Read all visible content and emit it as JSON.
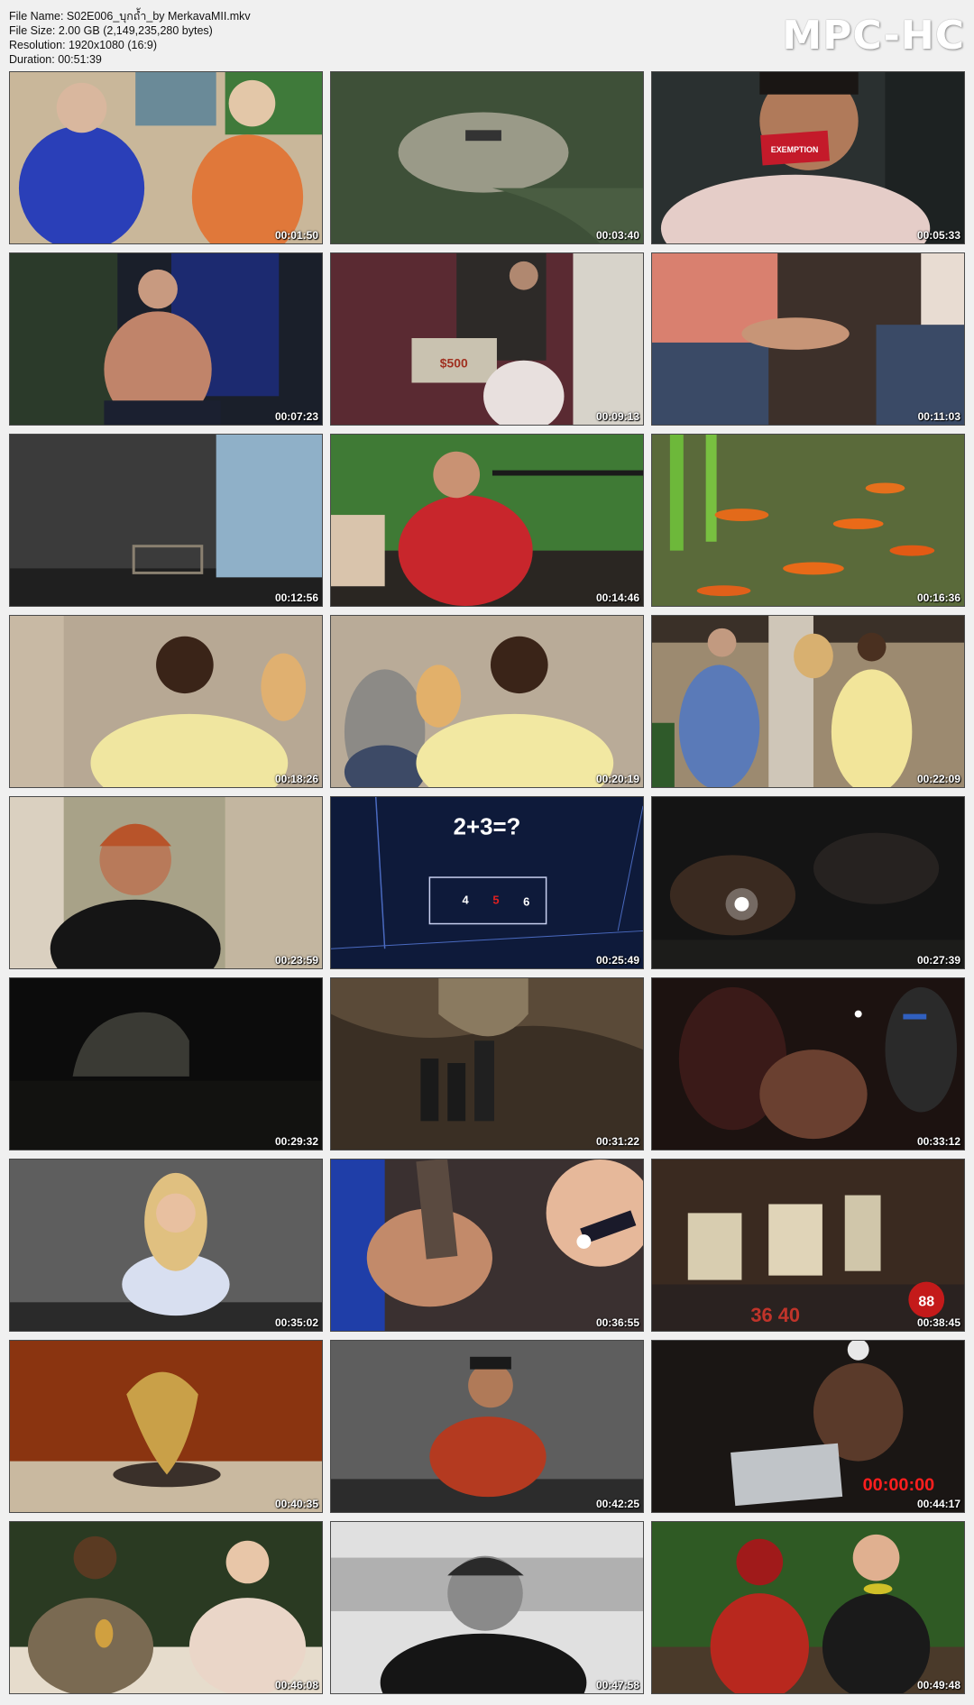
{
  "header": {
    "file_name": "File Name: S02E006_บุกถ้ำ_by MerkavaMII.mkv",
    "file_size": "File Size: 2.00 GB (2,149,235,280 bytes)",
    "resolution": "Resolution: 1920x1080 (16:9)",
    "duration": "Duration: 00:51:39"
  },
  "logo": "MPC-HC",
  "thumbnails": [
    {
      "time": "00:01:50"
    },
    {
      "time": "00:03:40"
    },
    {
      "time": "00:05:33",
      "overlay": "EXEMPTION"
    },
    {
      "time": "00:07:23"
    },
    {
      "time": "00:09:13",
      "overlay": "$500"
    },
    {
      "time": "00:11:03"
    },
    {
      "time": "00:12:56"
    },
    {
      "time": "00:14:46"
    },
    {
      "time": "00:16:36"
    },
    {
      "time": "00:18:26"
    },
    {
      "time": "00:20:19"
    },
    {
      "time": "00:22:09"
    },
    {
      "time": "00:23:59"
    },
    {
      "time": "00:25:49",
      "overlay": "2+3=?",
      "overlay_a": "4",
      "overlay_b": "5",
      "overlay_c": "6"
    },
    {
      "time": "00:27:39"
    },
    {
      "time": "00:29:32"
    },
    {
      "time": "00:31:22"
    },
    {
      "time": "00:33:12"
    },
    {
      "time": "00:35:02"
    },
    {
      "time": "00:36:55"
    },
    {
      "time": "00:38:45",
      "overlay": "36  40",
      "overlay_b": "88"
    },
    {
      "time": "00:40:35"
    },
    {
      "time": "00:42:25"
    },
    {
      "time": "00:44:17",
      "overlay": "00:00:00"
    },
    {
      "time": "00:46:08"
    },
    {
      "time": "00:47:58"
    },
    {
      "time": "00:49:48"
    }
  ]
}
